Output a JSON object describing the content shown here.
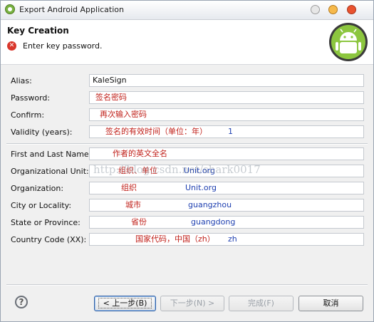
{
  "window": {
    "title": "Export Android Application"
  },
  "header": {
    "title": "Key Creation",
    "message": "Enter key password."
  },
  "form": {
    "alias": {
      "label": "Alias:",
      "value": "KaleSign"
    },
    "password": {
      "label": "Password:",
      "note": "签名密码"
    },
    "confirm": {
      "label": "Confirm:",
      "note": "再次输入密码"
    },
    "validity": {
      "label": "Validity (years):",
      "note": "签名的有效时间（单位：年）",
      "value": "1"
    },
    "name": {
      "label": "First and Last Name:",
      "note": "作者的英文全名"
    },
    "unit": {
      "label": "Organizational Unit:",
      "note": "组织、单位",
      "value": "Unit.org"
    },
    "organization": {
      "label": "Organization:",
      "note": "组织",
      "value": "Unit.org"
    },
    "city": {
      "label": "City or Locality:",
      "note": "城市",
      "value": "guangzhou"
    },
    "state": {
      "label": "State or Province:",
      "note": "省份",
      "value": "guangdong"
    },
    "country": {
      "label": "Country Code (XX):",
      "note": "国家代码，中国（zh）",
      "value": "zh"
    }
  },
  "watermark": "http://blog.csdn.net/shark0017",
  "footer": {
    "help": "?",
    "back": "< 上一步(B)",
    "next": "下一步(N) >",
    "finish": "完成(F)",
    "cancel": "取消"
  }
}
